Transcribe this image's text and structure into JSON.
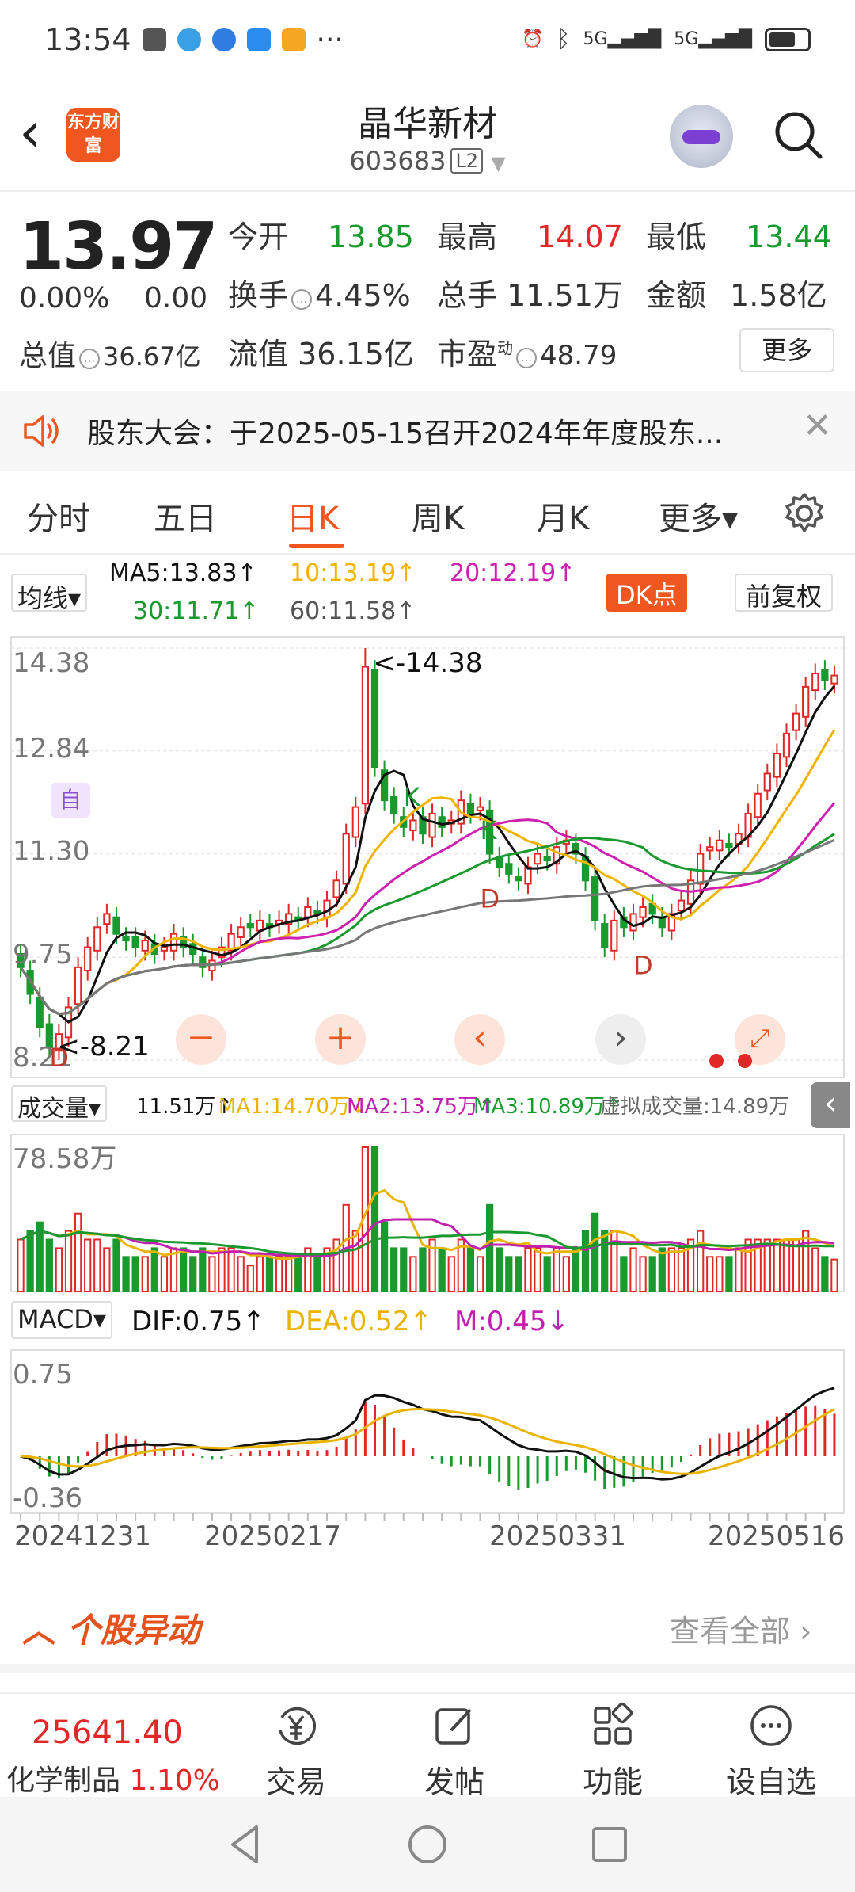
{
  "status_bar": {
    "time": "13:54",
    "dots": "···",
    "net1": "5G",
    "net2": "5G"
  },
  "header": {
    "logo_text": "东方财富",
    "stock_name": "晶华新材",
    "stock_code": "603683",
    "level": "L2"
  },
  "quote": {
    "price": "13.97",
    "change_pct": "0.00%",
    "change": "0.00",
    "total_value_label": "总值",
    "total_value": "36.67亿",
    "open_label": "今开",
    "open": "13.85",
    "high_label": "最高",
    "high": "14.07",
    "low_label": "最低",
    "low": "13.44",
    "turnover_label": "换手",
    "turnover": "4.45%",
    "volume_label": "总手",
    "volume": "11.51万",
    "amount_label": "金额",
    "amount": "1.58亿",
    "float_label": "流值",
    "float_value": "36.15亿",
    "pe_label": "市盈",
    "pe_sup": "动",
    "pe": "48.79",
    "more": "更多"
  },
  "notice": {
    "text": "股东大会：于2025-05-15召开2024年年度股东..."
  },
  "tabs": [
    {
      "label": "分时"
    },
    {
      "label": "五日"
    },
    {
      "label": "日K"
    },
    {
      "label": "周K"
    },
    {
      "label": "月K"
    },
    {
      "label": "更多▾"
    }
  ],
  "kline": {
    "ma_select": "均线▾",
    "ma5": "MA5:13.83↑",
    "ma10": "10:13.19↑",
    "ma20": "20:12.19↑",
    "ma30": "30:11.71↑",
    "ma60": "60:11.58↑",
    "dk": "DK点",
    "fq": "前复权",
    "y_labels": [
      "14.38",
      "12.84",
      "11.30",
      "9.75",
      "8.21"
    ],
    "max_marker": "<-14.38",
    "min_marker": "<-8.21",
    "self_tag": "自",
    "k_marks": [
      "K",
      "K"
    ],
    "d_marks": [
      "D",
      "D",
      "D"
    ]
  },
  "volume": {
    "select": "成交量▾",
    "v": "11.51万↑",
    "ma1": "MA1:14.70万↓",
    "ma2": "MA2:13.75万↑",
    "ma3": "MA3:10.89万↑",
    "virtual": "虚拟成交量:14.89万",
    "y_label": "78.58万"
  },
  "macd": {
    "select": "MACD▾",
    "dif": "DIF:0.75↑",
    "dea": "DEA:0.52↑",
    "m": "M:0.45↓",
    "y_top": "0.75",
    "y_bottom": "-0.36"
  },
  "x_labels": [
    "20241231",
    "20250217",
    "20250331",
    "20250516"
  ],
  "movers": {
    "title": "个股异动",
    "view_all": "查看全部"
  },
  "bottom": {
    "index_value": "25641.40",
    "index_name": "化学制品",
    "index_pct": "1.10%",
    "nav": [
      "交易",
      "发帖",
      "功能",
      "设自选"
    ]
  },
  "colors": {
    "accent": "#f0561f",
    "up": "#e02828",
    "down": "#1a9a2e",
    "ma5": "#111111",
    "ma10": "#f0b400",
    "ma20": "#d020b0",
    "ma30": "#1a9a2e",
    "ma60": "#777777"
  },
  "chart_data": {
    "type": "candlestick",
    "ylim": [
      8.21,
      14.38
    ],
    "x_ticks": [
      "20241231",
      "20250217",
      "20250331",
      "20250516"
    ],
    "close_series": [
      9.6,
      9.2,
      8.7,
      8.4,
      8.6,
      9.0,
      9.6,
      9.9,
      10.2,
      10.4,
      10.1,
      10.0,
      9.9,
      10.0,
      9.8,
      9.9,
      10.1,
      9.9,
      9.8,
      9.6,
      9.7,
      9.9,
      10.1,
      10.2,
      10.2,
      10.3,
      10.2,
      10.3,
      10.4,
      10.3,
      10.5,
      10.4,
      10.6,
      10.9,
      11.6,
      12.0,
      14.1,
      12.6,
      12.1,
      11.9,
      11.7,
      11.8,
      11.6,
      11.9,
      11.7,
      11.8,
      12.1,
      11.9,
      12.0,
      11.3,
      11.1,
      11.0,
      10.9,
      11.1,
      11.3,
      11.2,
      11.4,
      11.5,
      11.3,
      10.9,
      10.3,
      9.9,
      10.3,
      10.2,
      10.4,
      10.5,
      10.4,
      10.2,
      10.4,
      10.6,
      10.9,
      11.3,
      11.4,
      11.5,
      11.4,
      11.6,
      11.9,
      12.2,
      12.5,
      12.8,
      13.1,
      13.4,
      13.8,
      14.0,
      13.9,
      13.97
    ],
    "ma5": "13.83",
    "ma10": "13.19",
    "ma20": "12.19",
    "ma30": "11.71",
    "ma60": "11.58"
  }
}
